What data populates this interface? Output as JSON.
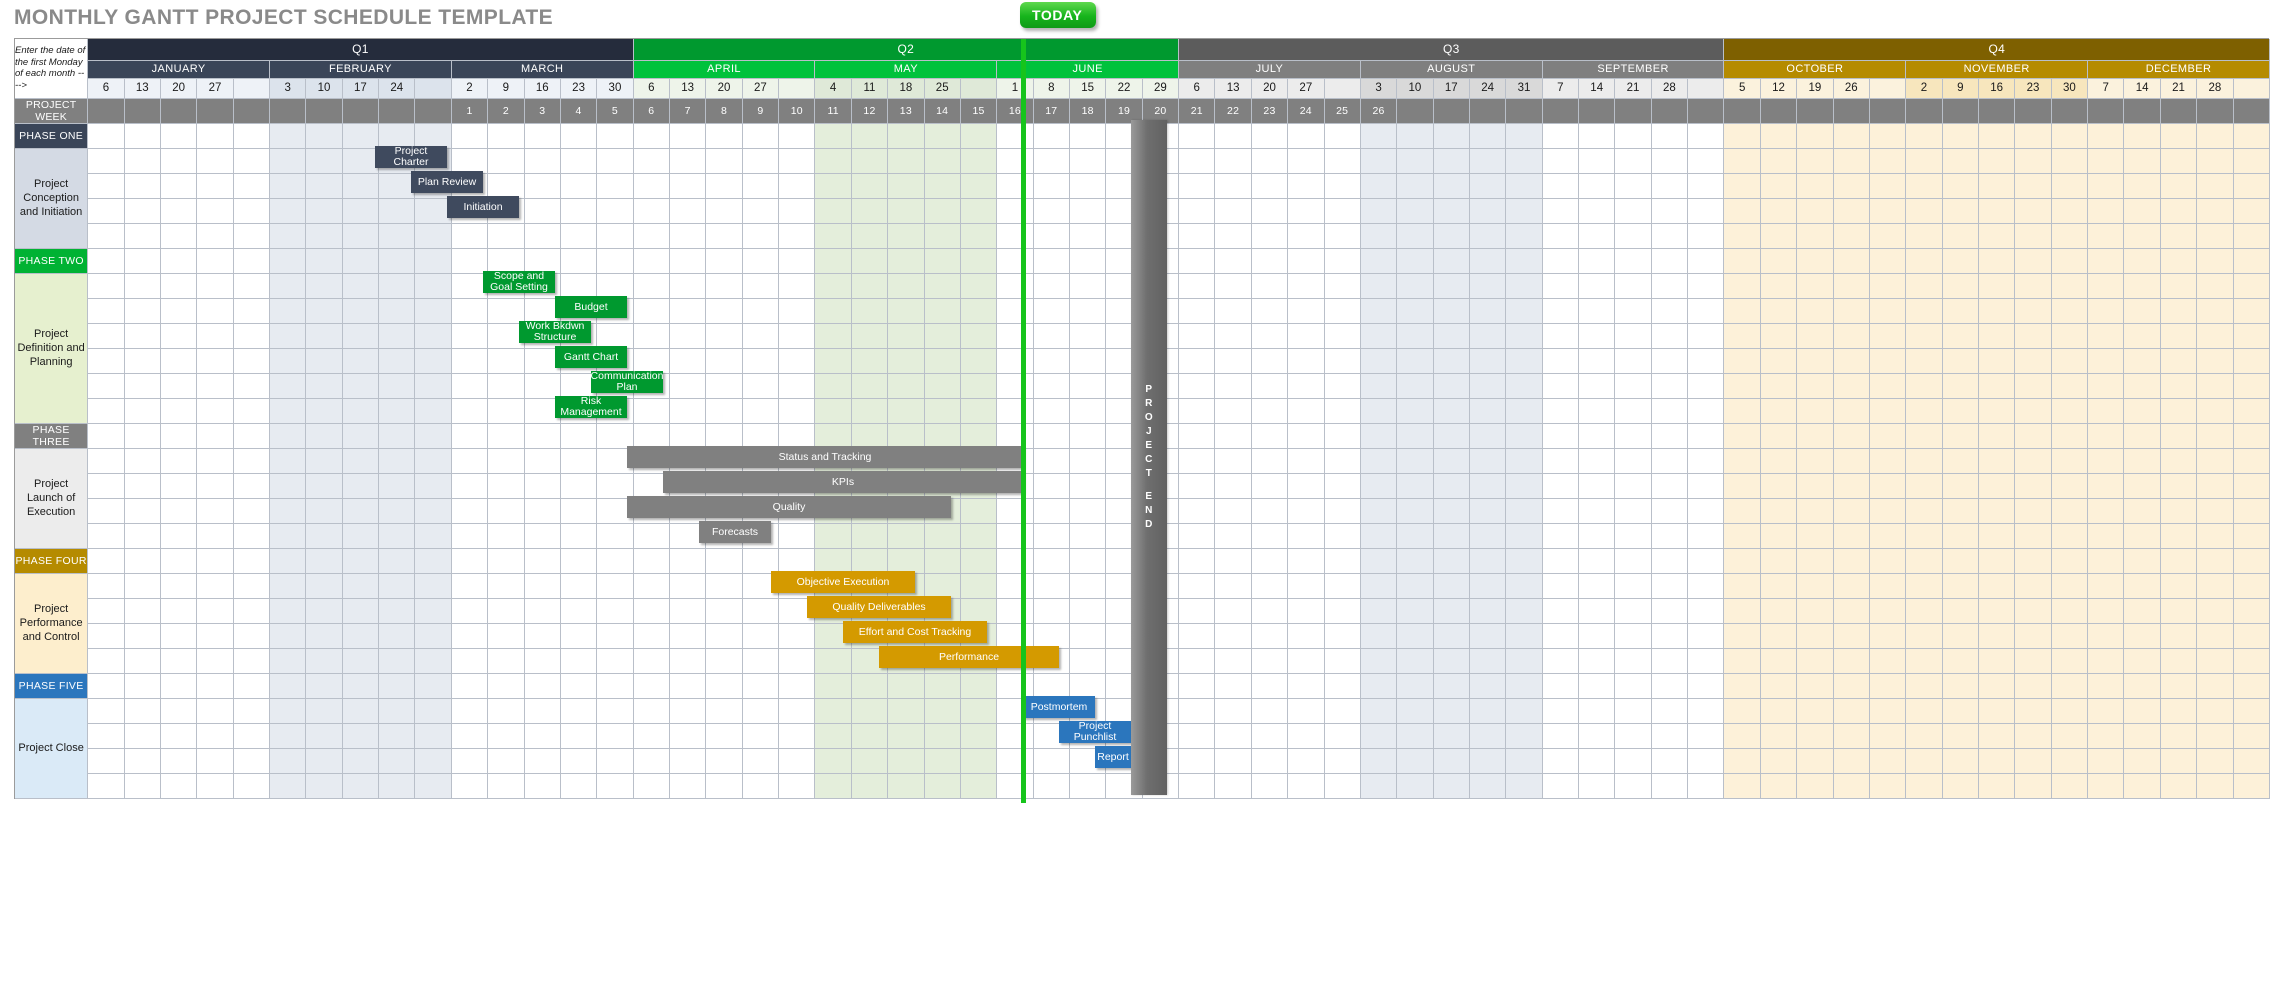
{
  "page": {
    "title": "MONTHLY GANTT PROJECT SCHEDULE TEMPLATE",
    "corner_note": "Enter the date of the first Monday of each month ---->",
    "project_week_label": "PROJECT WEEK",
    "today_label": "TODAY",
    "project_end_label": "PROJECT END"
  },
  "colors": {
    "q1": "#252c3c",
    "q1_month": "#3a4558",
    "q2": "#00992f",
    "q2_month": "#00c23c",
    "q3": "#5c5c5c",
    "q3_month": "#7f7f7f",
    "q4": "#7e6000",
    "q4_month": "#b58b00",
    "phase_one": "#3a4558",
    "phase_two": "#00b233",
    "phase_three": "#808080",
    "phase_four": "#b58b00",
    "phase_five": "#2b76bd",
    "today": "#16c41c",
    "project_end": "#6e6e6e",
    "project_week_row": "#808080"
  },
  "quarters": [
    {
      "label": "Q1",
      "tone": "q1",
      "months": [
        {
          "name": "JANUARY",
          "dates": [
            "6",
            "13",
            "20",
            "27",
            ""
          ]
        },
        {
          "name": "FEBRUARY",
          "dates": [
            "3",
            "10",
            "17",
            "24",
            ""
          ]
        },
        {
          "name": "MARCH",
          "dates": [
            "2",
            "9",
            "16",
            "23",
            "30"
          ]
        }
      ]
    },
    {
      "label": "Q2",
      "tone": "q2",
      "months": [
        {
          "name": "APRIL",
          "dates": [
            "6",
            "13",
            "20",
            "27",
            ""
          ]
        },
        {
          "name": "MAY",
          "dates": [
            "4",
            "11",
            "18",
            "25",
            ""
          ]
        },
        {
          "name": "JUNE",
          "dates": [
            "1",
            "8",
            "15",
            "22",
            "29"
          ]
        }
      ]
    },
    {
      "label": "Q3",
      "tone": "q3",
      "months": [
        {
          "name": "JULY",
          "dates": [
            "6",
            "13",
            "20",
            "27",
            ""
          ]
        },
        {
          "name": "AUGUST",
          "dates": [
            "3",
            "10",
            "17",
            "24",
            "31"
          ]
        },
        {
          "name": "SEPTEMBER",
          "dates": [
            "7",
            "14",
            "21",
            "28",
            ""
          ]
        }
      ]
    },
    {
      "label": "Q4",
      "tone": "q4",
      "months": [
        {
          "name": "OCTOBER",
          "dates": [
            "5",
            "12",
            "19",
            "26",
            ""
          ]
        },
        {
          "name": "NOVEMBER",
          "dates": [
            "2",
            "9",
            "16",
            "23",
            "30"
          ]
        },
        {
          "name": "DECEMBER",
          "dates": [
            "7",
            "14",
            "21",
            "28",
            ""
          ]
        }
      ]
    }
  ],
  "project_week_start_col": 10,
  "project_week_count": 26,
  "phases": [
    {
      "band_label": "PHASE ONE",
      "tone": "1",
      "name": "Project Conception and Initiation",
      "rows": 4,
      "tasks": [
        {
          "label": "Project Charter",
          "row": 0,
          "start": 8,
          "span": 2,
          "tone": "navy"
        },
        {
          "label": "Plan Review",
          "row": 1,
          "start": 9,
          "span": 2,
          "tone": "navy"
        },
        {
          "label": "Initiation",
          "row": 2,
          "start": 10,
          "span": 2,
          "tone": "navy"
        }
      ]
    },
    {
      "band_label": "PHASE TWO",
      "tone": "2",
      "name": "Project Definition and Planning",
      "rows": 6,
      "tasks": [
        {
          "label": "Scope and Goal Setting",
          "row": 0,
          "start": 11,
          "span": 2,
          "tone": "green"
        },
        {
          "label": "Budget",
          "row": 1,
          "start": 13,
          "span": 2,
          "tone": "green"
        },
        {
          "label": "Work Bkdwn Structure",
          "row": 2,
          "start": 12,
          "span": 2,
          "tone": "green"
        },
        {
          "label": "Gantt Chart",
          "row": 3,
          "start": 13,
          "span": 2,
          "tone": "green"
        },
        {
          "label": "Communication Plan",
          "row": 4,
          "start": 14,
          "span": 2,
          "tone": "green"
        },
        {
          "label": "Risk Management",
          "row": 5,
          "start": 13,
          "span": 2,
          "tone": "green"
        }
      ]
    },
    {
      "band_label": "PHASE THREE",
      "tone": "3",
      "name": "Project Launch of Execution",
      "rows": 4,
      "tasks": [
        {
          "label": "Status  and Tracking",
          "row": 0,
          "start": 15,
          "span": 11,
          "tone": "gray"
        },
        {
          "label": "KPIs",
          "row": 1,
          "start": 16,
          "span": 10,
          "tone": "gray"
        },
        {
          "label": "Quality",
          "row": 2,
          "start": 15,
          "span": 9,
          "tone": "gray"
        },
        {
          "label": "Forecasts",
          "row": 3,
          "start": 17,
          "span": 2,
          "tone": "gray"
        }
      ]
    },
    {
      "band_label": "PHASE FOUR",
      "tone": "4",
      "name": "Project Performance and Control",
      "rows": 4,
      "tasks": [
        {
          "label": "Objective Execution",
          "row": 0,
          "start": 19,
          "span": 4,
          "tone": "gold"
        },
        {
          "label": "Quality Deliverables",
          "row": 1,
          "start": 20,
          "span": 4,
          "tone": "gold"
        },
        {
          "label": "Effort and Cost Tracking",
          "row": 2,
          "start": 21,
          "span": 4,
          "tone": "gold"
        },
        {
          "label": "Performance",
          "row": 3,
          "start": 22,
          "span": 5,
          "tone": "gold"
        }
      ]
    },
    {
      "band_label": "PHASE FIVE",
      "tone": "5",
      "name": "Project Close",
      "rows": 4,
      "tasks": [
        {
          "label": "Postmortem",
          "row": 0,
          "start": 26,
          "span": 2,
          "tone": "blue"
        },
        {
          "label": "Project Punchlist",
          "row": 1,
          "start": 27,
          "span": 2,
          "tone": "blue"
        },
        {
          "label": "Report",
          "row": 2,
          "start": 28,
          "span": 1,
          "tone": "blue"
        }
      ]
    }
  ],
  "today_col": 26,
  "project_end_col": 29,
  "shaded_month_cols": [
    [
      5,
      9
    ],
    [
      18,
      22
    ],
    [
      31,
      35
    ],
    [
      44,
      48
    ]
  ],
  "green_band_cols": [
    40,
    44
  ],
  "yellow_band_cols": [
    [
      40,
      48
    ]
  ]
}
